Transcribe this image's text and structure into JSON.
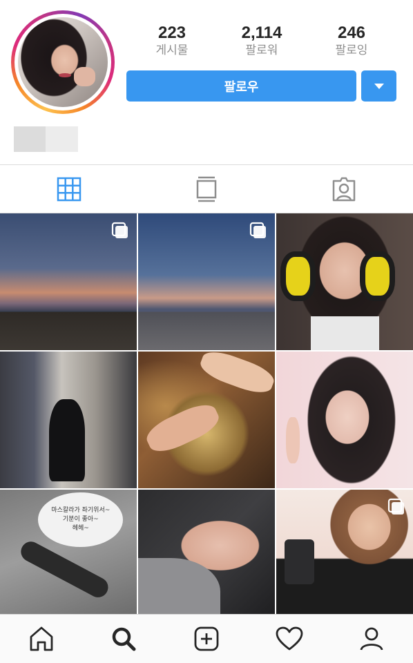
{
  "profile": {
    "stats": [
      {
        "value": "223",
        "label": "게시물"
      },
      {
        "value": "2,114",
        "label": "팔로워"
      },
      {
        "value": "246",
        "label": "팔로잉"
      }
    ],
    "follow_label": "팔로우",
    "dropdown_icon": "caret-down-icon"
  },
  "tabs": [
    {
      "icon": "grid-icon",
      "active": true
    },
    {
      "icon": "feed-list-icon",
      "active": false
    },
    {
      "icon": "tagged-person-icon",
      "active": false
    }
  ],
  "posts": [
    {
      "icon": "multiple-photos-icon",
      "multiple": true
    },
    {
      "icon": "multiple-photos-icon",
      "multiple": true
    },
    {
      "multiple": false
    },
    {
      "multiple": false
    },
    {
      "multiple": false
    },
    {
      "multiple": false
    },
    {
      "multiple": false,
      "caption": "마스칼라가 좌기위서~\n기분이 좋아~\n헤헤~"
    },
    {
      "multiple": false
    },
    {
      "icon": "multiple-photos-icon",
      "multiple": true
    }
  ],
  "bottom_nav": [
    {
      "icon": "home-icon"
    },
    {
      "icon": "search-icon",
      "active": true
    },
    {
      "icon": "add-post-icon"
    },
    {
      "icon": "heart-icon"
    },
    {
      "icon": "profile-icon"
    }
  ],
  "colors": {
    "accent": "#3897f0",
    "text": "#262626",
    "muted": "#8e8e8e",
    "divider": "#dbdbdb"
  }
}
